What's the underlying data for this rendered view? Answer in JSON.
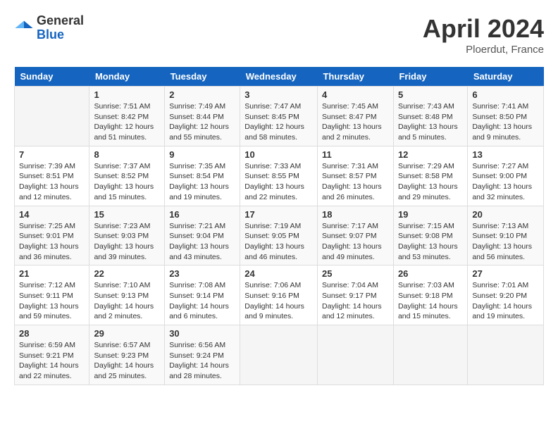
{
  "header": {
    "logo_general": "General",
    "logo_blue": "Blue",
    "month_title": "April 2024",
    "location": "Ploerdut, France"
  },
  "days_of_week": [
    "Sunday",
    "Monday",
    "Tuesday",
    "Wednesday",
    "Thursday",
    "Friday",
    "Saturday"
  ],
  "weeks": [
    [
      {
        "day": "",
        "info": ""
      },
      {
        "day": "1",
        "info": "Sunrise: 7:51 AM\nSunset: 8:42 PM\nDaylight: 12 hours\nand 51 minutes."
      },
      {
        "day": "2",
        "info": "Sunrise: 7:49 AM\nSunset: 8:44 PM\nDaylight: 12 hours\nand 55 minutes."
      },
      {
        "day": "3",
        "info": "Sunrise: 7:47 AM\nSunset: 8:45 PM\nDaylight: 12 hours\nand 58 minutes."
      },
      {
        "day": "4",
        "info": "Sunrise: 7:45 AM\nSunset: 8:47 PM\nDaylight: 13 hours\nand 2 minutes."
      },
      {
        "day": "5",
        "info": "Sunrise: 7:43 AM\nSunset: 8:48 PM\nDaylight: 13 hours\nand 5 minutes."
      },
      {
        "day": "6",
        "info": "Sunrise: 7:41 AM\nSunset: 8:50 PM\nDaylight: 13 hours\nand 9 minutes."
      }
    ],
    [
      {
        "day": "7",
        "info": "Sunrise: 7:39 AM\nSunset: 8:51 PM\nDaylight: 13 hours\nand 12 minutes."
      },
      {
        "day": "8",
        "info": "Sunrise: 7:37 AM\nSunset: 8:52 PM\nDaylight: 13 hours\nand 15 minutes."
      },
      {
        "day": "9",
        "info": "Sunrise: 7:35 AM\nSunset: 8:54 PM\nDaylight: 13 hours\nand 19 minutes."
      },
      {
        "day": "10",
        "info": "Sunrise: 7:33 AM\nSunset: 8:55 PM\nDaylight: 13 hours\nand 22 minutes."
      },
      {
        "day": "11",
        "info": "Sunrise: 7:31 AM\nSunset: 8:57 PM\nDaylight: 13 hours\nand 26 minutes."
      },
      {
        "day": "12",
        "info": "Sunrise: 7:29 AM\nSunset: 8:58 PM\nDaylight: 13 hours\nand 29 minutes."
      },
      {
        "day": "13",
        "info": "Sunrise: 7:27 AM\nSunset: 9:00 PM\nDaylight: 13 hours\nand 32 minutes."
      }
    ],
    [
      {
        "day": "14",
        "info": "Sunrise: 7:25 AM\nSunset: 9:01 PM\nDaylight: 13 hours\nand 36 minutes."
      },
      {
        "day": "15",
        "info": "Sunrise: 7:23 AM\nSunset: 9:03 PM\nDaylight: 13 hours\nand 39 minutes."
      },
      {
        "day": "16",
        "info": "Sunrise: 7:21 AM\nSunset: 9:04 PM\nDaylight: 13 hours\nand 43 minutes."
      },
      {
        "day": "17",
        "info": "Sunrise: 7:19 AM\nSunset: 9:05 PM\nDaylight: 13 hours\nand 46 minutes."
      },
      {
        "day": "18",
        "info": "Sunrise: 7:17 AM\nSunset: 9:07 PM\nDaylight: 13 hours\nand 49 minutes."
      },
      {
        "day": "19",
        "info": "Sunrise: 7:15 AM\nSunset: 9:08 PM\nDaylight: 13 hours\nand 53 minutes."
      },
      {
        "day": "20",
        "info": "Sunrise: 7:13 AM\nSunset: 9:10 PM\nDaylight: 13 hours\nand 56 minutes."
      }
    ],
    [
      {
        "day": "21",
        "info": "Sunrise: 7:12 AM\nSunset: 9:11 PM\nDaylight: 13 hours\nand 59 minutes."
      },
      {
        "day": "22",
        "info": "Sunrise: 7:10 AM\nSunset: 9:13 PM\nDaylight: 14 hours\nand 2 minutes."
      },
      {
        "day": "23",
        "info": "Sunrise: 7:08 AM\nSunset: 9:14 PM\nDaylight: 14 hours\nand 6 minutes."
      },
      {
        "day": "24",
        "info": "Sunrise: 7:06 AM\nSunset: 9:16 PM\nDaylight: 14 hours\nand 9 minutes."
      },
      {
        "day": "25",
        "info": "Sunrise: 7:04 AM\nSunset: 9:17 PM\nDaylight: 14 hours\nand 12 minutes."
      },
      {
        "day": "26",
        "info": "Sunrise: 7:03 AM\nSunset: 9:18 PM\nDaylight: 14 hours\nand 15 minutes."
      },
      {
        "day": "27",
        "info": "Sunrise: 7:01 AM\nSunset: 9:20 PM\nDaylight: 14 hours\nand 19 minutes."
      }
    ],
    [
      {
        "day": "28",
        "info": "Sunrise: 6:59 AM\nSunset: 9:21 PM\nDaylight: 14 hours\nand 22 minutes."
      },
      {
        "day": "29",
        "info": "Sunrise: 6:57 AM\nSunset: 9:23 PM\nDaylight: 14 hours\nand 25 minutes."
      },
      {
        "day": "30",
        "info": "Sunrise: 6:56 AM\nSunset: 9:24 PM\nDaylight: 14 hours\nand 28 minutes."
      },
      {
        "day": "",
        "info": ""
      },
      {
        "day": "",
        "info": ""
      },
      {
        "day": "",
        "info": ""
      },
      {
        "day": "",
        "info": ""
      }
    ]
  ]
}
